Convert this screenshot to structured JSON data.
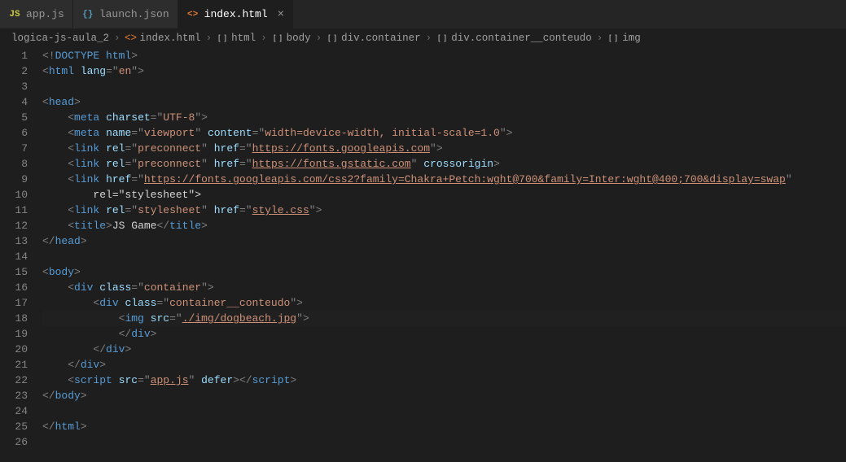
{
  "tabs": [
    {
      "icon": "JS",
      "iconClass": "icon-js",
      "label": "app.js",
      "active": false,
      "close": false
    },
    {
      "icon": "{}",
      "iconClass": "icon-json",
      "label": "launch.json",
      "active": false,
      "close": false
    },
    {
      "icon": "<>",
      "iconClass": "icon-html",
      "label": "index.html",
      "active": true,
      "close": true
    }
  ],
  "breadcrumbs": [
    {
      "label": "logica-js-aula_2",
      "icon": ""
    },
    {
      "label": "index.html",
      "icon": "html"
    },
    {
      "label": "html",
      "icon": "brackets"
    },
    {
      "label": "body",
      "icon": "brackets"
    },
    {
      "label": "div.container",
      "icon": "brackets"
    },
    {
      "label": "div.container__conteudo",
      "icon": "brackets"
    },
    {
      "label": "img",
      "icon": "brackets"
    }
  ],
  "code": {
    "line_count": 26,
    "highlighted_line": 18,
    "lines": [
      {
        "raw": "<!DOCTYPE html>"
      },
      {
        "raw": "<html lang=\"en\">"
      },
      {
        "raw": ""
      },
      {
        "raw": "<head>"
      },
      {
        "raw": "    <meta charset=\"UTF-8\">"
      },
      {
        "raw": "    <meta name=\"viewport\" content=\"width=device-width, initial-scale=1.0\">"
      },
      {
        "raw": "    <link rel=\"preconnect\" href=\"https://fonts.googleapis.com\">"
      },
      {
        "raw": "    <link rel=\"preconnect\" href=\"https://fonts.gstatic.com\" crossorigin>"
      },
      {
        "raw": "    <link href=\"https://fonts.googleapis.com/css2?family=Chakra+Petch:wght@700&family=Inter:wght@400;700&display=swap\""
      },
      {
        "raw": "        rel=\"stylesheet\">"
      },
      {
        "raw": "    <link rel=\"stylesheet\" href=\"style.css\">"
      },
      {
        "raw": "    <title>JS Game</title>"
      },
      {
        "raw": "</head>"
      },
      {
        "raw": ""
      },
      {
        "raw": "<body>"
      },
      {
        "raw": "    <div class=\"container\">"
      },
      {
        "raw": "        <div class=\"container__conteudo\">"
      },
      {
        "raw": "            <img src=\"./img/dogbeach.jpg\">"
      },
      {
        "raw": "            </div>"
      },
      {
        "raw": "        </div>"
      },
      {
        "raw": "    </div>"
      },
      {
        "raw": "    <script src=\"app.js\" defer></script>"
      },
      {
        "raw": "</body>"
      },
      {
        "raw": ""
      },
      {
        "raw": "</html>"
      },
      {
        "raw": ""
      }
    ],
    "title_text": "JS Game",
    "underlined_urls": [
      "https://fonts.googleapis.com",
      "https://fonts.gstatic.com",
      "https://fonts.googleapis.com/css2?family=Chakra+Petch:wght@700&family=Inter:wght@400;700&display=swap",
      "style.css",
      "./img/dogbeach.jpg",
      "app.js"
    ]
  }
}
